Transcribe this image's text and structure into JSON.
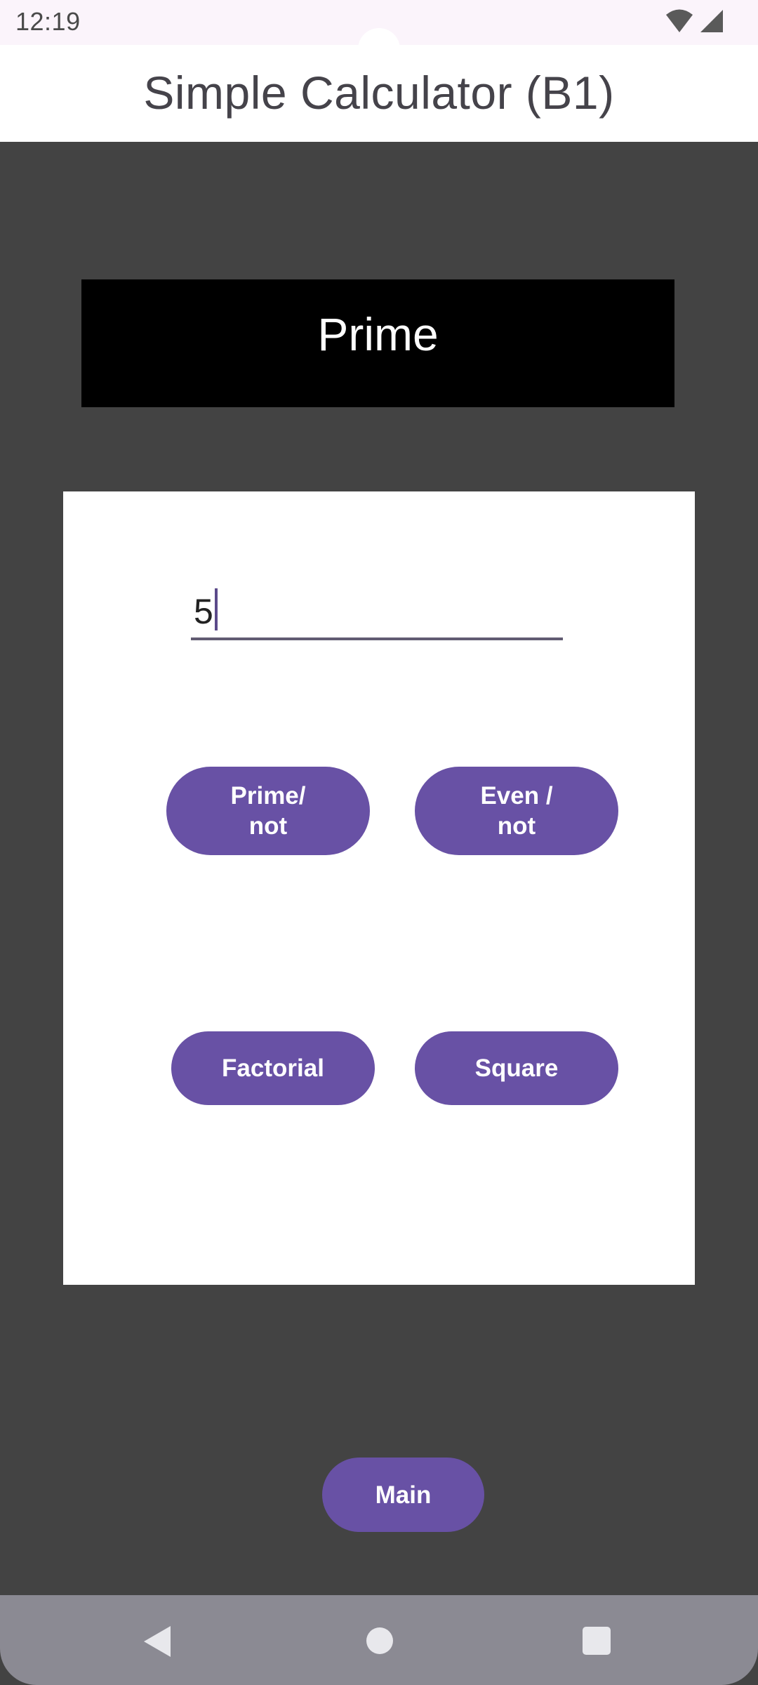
{
  "status_bar": {
    "time": "12:19",
    "wifi_icon": "wifi-icon",
    "signal_icon": "signal-icon"
  },
  "app_bar": {
    "title": "Simple Calculator (B1)"
  },
  "header": {
    "text": "Prime"
  },
  "input": {
    "value": "5"
  },
  "buttons": {
    "prime": "Prime/\nnot",
    "even": "Even  /\nnot",
    "factorial": "Factorial",
    "square": "Square",
    "main": "Main"
  },
  "nav": {
    "back_icon": "back-icon",
    "home_icon": "home-icon",
    "recents_icon": "recents-icon"
  },
  "colors": {
    "background": "#434343",
    "accent": "#6851a5",
    "header_bg": "#000000",
    "card_bg": "#ffffff",
    "nav_bar": "#8b8a93"
  }
}
